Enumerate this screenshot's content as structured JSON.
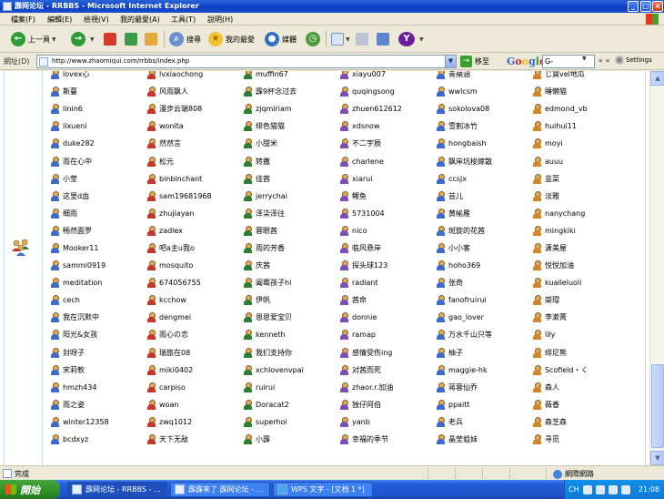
{
  "window": {
    "title": "霹网论坛 - RRBBS - Microsoft Internet Explorer"
  },
  "menu": [
    "檔案(F)",
    "編輯(E)",
    "檢視(V)",
    "我的最愛(A)",
    "工具(T)",
    "說明(H)"
  ],
  "toolbar": {
    "back": "上一頁",
    "search": "搜尋",
    "favorites": "我的最愛",
    "media": "媒體"
  },
  "address": {
    "label": "網址(D)",
    "url": "http://www.zhaomiqui.com/rrbbs/index.php",
    "go": "移至"
  },
  "google": {
    "logo": "Google",
    "input": "G-",
    "settings": "Settings"
  },
  "users": [
    "lovex心",
    "lvxiaochong",
    "muffin67",
    "xiayu007",
    "青蘋涵",
    "じ寶vel地瓜",
    "斯蔓",
    "风雨飘人",
    "霹9杯念过去",
    "quqingsong",
    "wwlcsm",
    "睡懒猫",
    "linin6",
    "漫步云端808",
    "zjqmiriam",
    "zhuen612612",
    "sokolova08",
    "edmond_vb",
    "lixueni",
    "wonita",
    "绯色猫猫",
    "xdsnow",
    "雪割冰竹",
    "huihui11",
    "duke282",
    "然然言",
    "小甜米",
    "不二宇辰",
    "hongbaish",
    "moyi",
    "雨在心中",
    "松元",
    "转撒",
    "charlene",
    "飘岸坑梭嫁散",
    "auuu",
    "小莹",
    "binbinchant",
    "佳茜",
    "xiarui",
    "ccsjx",
    "韭菜",
    "这里d血",
    "sam19681968",
    "jerrychai",
    "鲤鱼",
    "芸儿",
    "淡雅",
    "细雨",
    "zhujiayan",
    "泽柒泽往",
    "5731004",
    "黄榆雁",
    "nanychang",
    "畅然面罗",
    "zadlex",
    "蓉眼茜",
    "nico",
    "斑旋的花茜",
    "mingkiki",
    "Mooker11",
    "吧a主u我o",
    "雨的芳香",
    "临风悬岸",
    "小小客",
    "潇美屋",
    "sammi0919",
    "mosquito",
    "庆茜",
    "探头球123",
    "hoho369",
    "悦悦加油",
    "meditation",
    "674056755",
    "阖霉孩子hl",
    "radiant",
    "张奇",
    "kuaileluoli",
    "cech",
    "kcchow",
    "伊帆",
    "茜命",
    "fanofruirui",
    "桀瑁",
    "我在沉默中",
    "dengmei",
    "恩恩爱宝贝",
    "donnie",
    "gao_lover",
    "李漱菁",
    "阳光&女孩",
    "雨心の恋",
    "kenneth",
    "ramap",
    "万水千山只等",
    "lily",
    "封呀子",
    "瑞旅在08",
    "我们支持你",
    "感情受伤ing",
    "柚子",
    "绯尼熊",
    "宋莉軟",
    "miki0402",
    "xchlovenvpai",
    "对茜而死",
    "maggie-hk",
    "Scofield・く",
    "hmzh434",
    "carpiso",
    "ruirui",
    "zhaor.r.加油",
    "蒋蓉仙乔",
    "森人",
    "雨之姿",
    "woan",
    "Doracat2",
    "独仔阿伯",
    "ppaitt",
    "薇香",
    "winter12358",
    "zwq1012",
    "superhoi",
    "yanb",
    "老兵",
    "森芝森",
    "bcdxyz",
    "天下无敌",
    "小霹",
    "幸福的季节",
    "晶莹姐妹",
    "寻觅"
  ],
  "status": {
    "text": "完成",
    "zone": "網際網路"
  },
  "taskbar": {
    "start": "開始",
    "tasks": [
      "霹网论坛 - RRBBS - ...",
      "霹霹来了 霹网论坛 - ...",
      "WPS 文字 - [文档 1 *]"
    ],
    "tray": {
      "lang": "CH",
      "time": "21:08"
    }
  },
  "colors": {
    "titlebar": "#0a3cc2",
    "taskbar": "#245edb",
    "start": "#2f8f25",
    "frame": "#c9d7f1"
  }
}
